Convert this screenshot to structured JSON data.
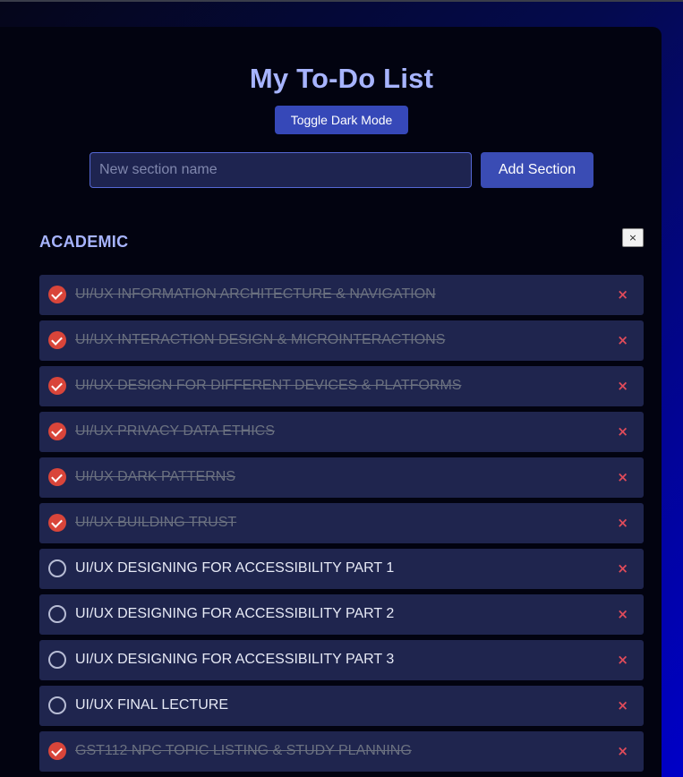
{
  "app": {
    "title": "My To-Do List",
    "toggle_label": "Toggle Dark Mode"
  },
  "new_section": {
    "placeholder": "New section name",
    "value": "",
    "add_label": "Add Section"
  },
  "section": {
    "name": "ACADEMIC",
    "remove_label": "×",
    "tasks": [
      {
        "text": "UI/UX INFORMATION ARCHITECTURE & NAVIGATION",
        "completed": true,
        "delete_label": "×"
      },
      {
        "text": "UI/UX INTERACTION DESIGN & MICROINTERACTIONS",
        "completed": true,
        "delete_label": "×"
      },
      {
        "text": "UI/UX DESIGN FOR DIFFERENT DEVICES & PLATFORMS",
        "completed": true,
        "delete_label": "×"
      },
      {
        "text": "UI/UX PRIVACY DATA ETHICS",
        "completed": true,
        "delete_label": "×"
      },
      {
        "text": "UI/UX DARK PATTERNS",
        "completed": true,
        "delete_label": "×"
      },
      {
        "text": "UI/UX BUILDING TRUST",
        "completed": true,
        "delete_label": "×"
      },
      {
        "text": "UI/UX DESIGNING FOR ACCESSIBILITY PART 1",
        "completed": false,
        "delete_label": "×"
      },
      {
        "text": "UI/UX DESIGNING FOR ACCESSIBILITY PART 2",
        "completed": false,
        "delete_label": "×"
      },
      {
        "text": "UI/UX DESIGNING FOR ACCESSIBILITY PART 3",
        "completed": false,
        "delete_label": "×"
      },
      {
        "text": "UI/UX FINAL LECTURE",
        "completed": false,
        "delete_label": "×"
      },
      {
        "text": "GST112 NPC TOPIC LISTING & STUDY PLANNING",
        "completed": true,
        "delete_label": "×"
      }
    ]
  },
  "colors": {
    "accent": "#a7b4ff",
    "button": "#3a4cb4",
    "task_bg": "#1f254e",
    "done_check": "#d9453a",
    "delete": "#e04b5a"
  },
  "icons": {
    "completed": "check-circle-icon",
    "pending": "empty-circle-icon",
    "delete": "close-icon"
  }
}
